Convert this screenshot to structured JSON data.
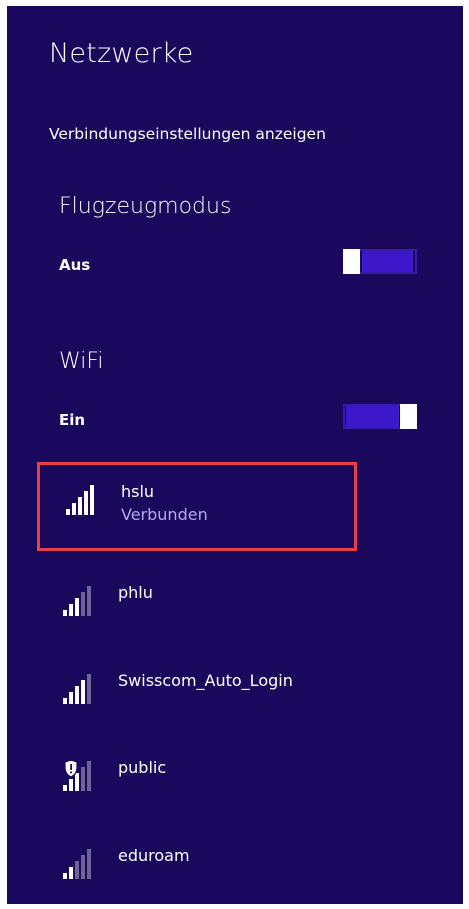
{
  "header": {
    "title": "Netzwerke",
    "connection_settings_link": "Verbindungseinstellungen anzeigen"
  },
  "airplane_mode": {
    "title": "Flugzeugmodus",
    "state_label": "Aus",
    "enabled": false
  },
  "wifi": {
    "title": "WiFi",
    "state_label": "Ein",
    "enabled": true
  },
  "networks": [
    {
      "name": "hslu",
      "status": "Verbunden",
      "signal_icon": "wifi-signal-icon",
      "secured_warning": false,
      "selected": true
    },
    {
      "name": "phlu",
      "status": "",
      "signal_icon": "wifi-signal-icon",
      "secured_warning": false,
      "selected": false
    },
    {
      "name": "Swisscom_Auto_Login",
      "status": "",
      "signal_icon": "wifi-signal-icon",
      "secured_warning": false,
      "selected": false
    },
    {
      "name": "public",
      "status": "",
      "signal_icon": "wifi-signal-shield-icon",
      "secured_warning": true,
      "selected": false
    },
    {
      "name": "eduroam",
      "status": "",
      "signal_icon": "wifi-signal-icon",
      "secured_warning": false,
      "selected": false
    }
  ],
  "colors": {
    "background": "#1a085c",
    "accent": "#3b18c9",
    "selection_border": "#e6404a",
    "secondary_text": "#b7a6f0"
  }
}
